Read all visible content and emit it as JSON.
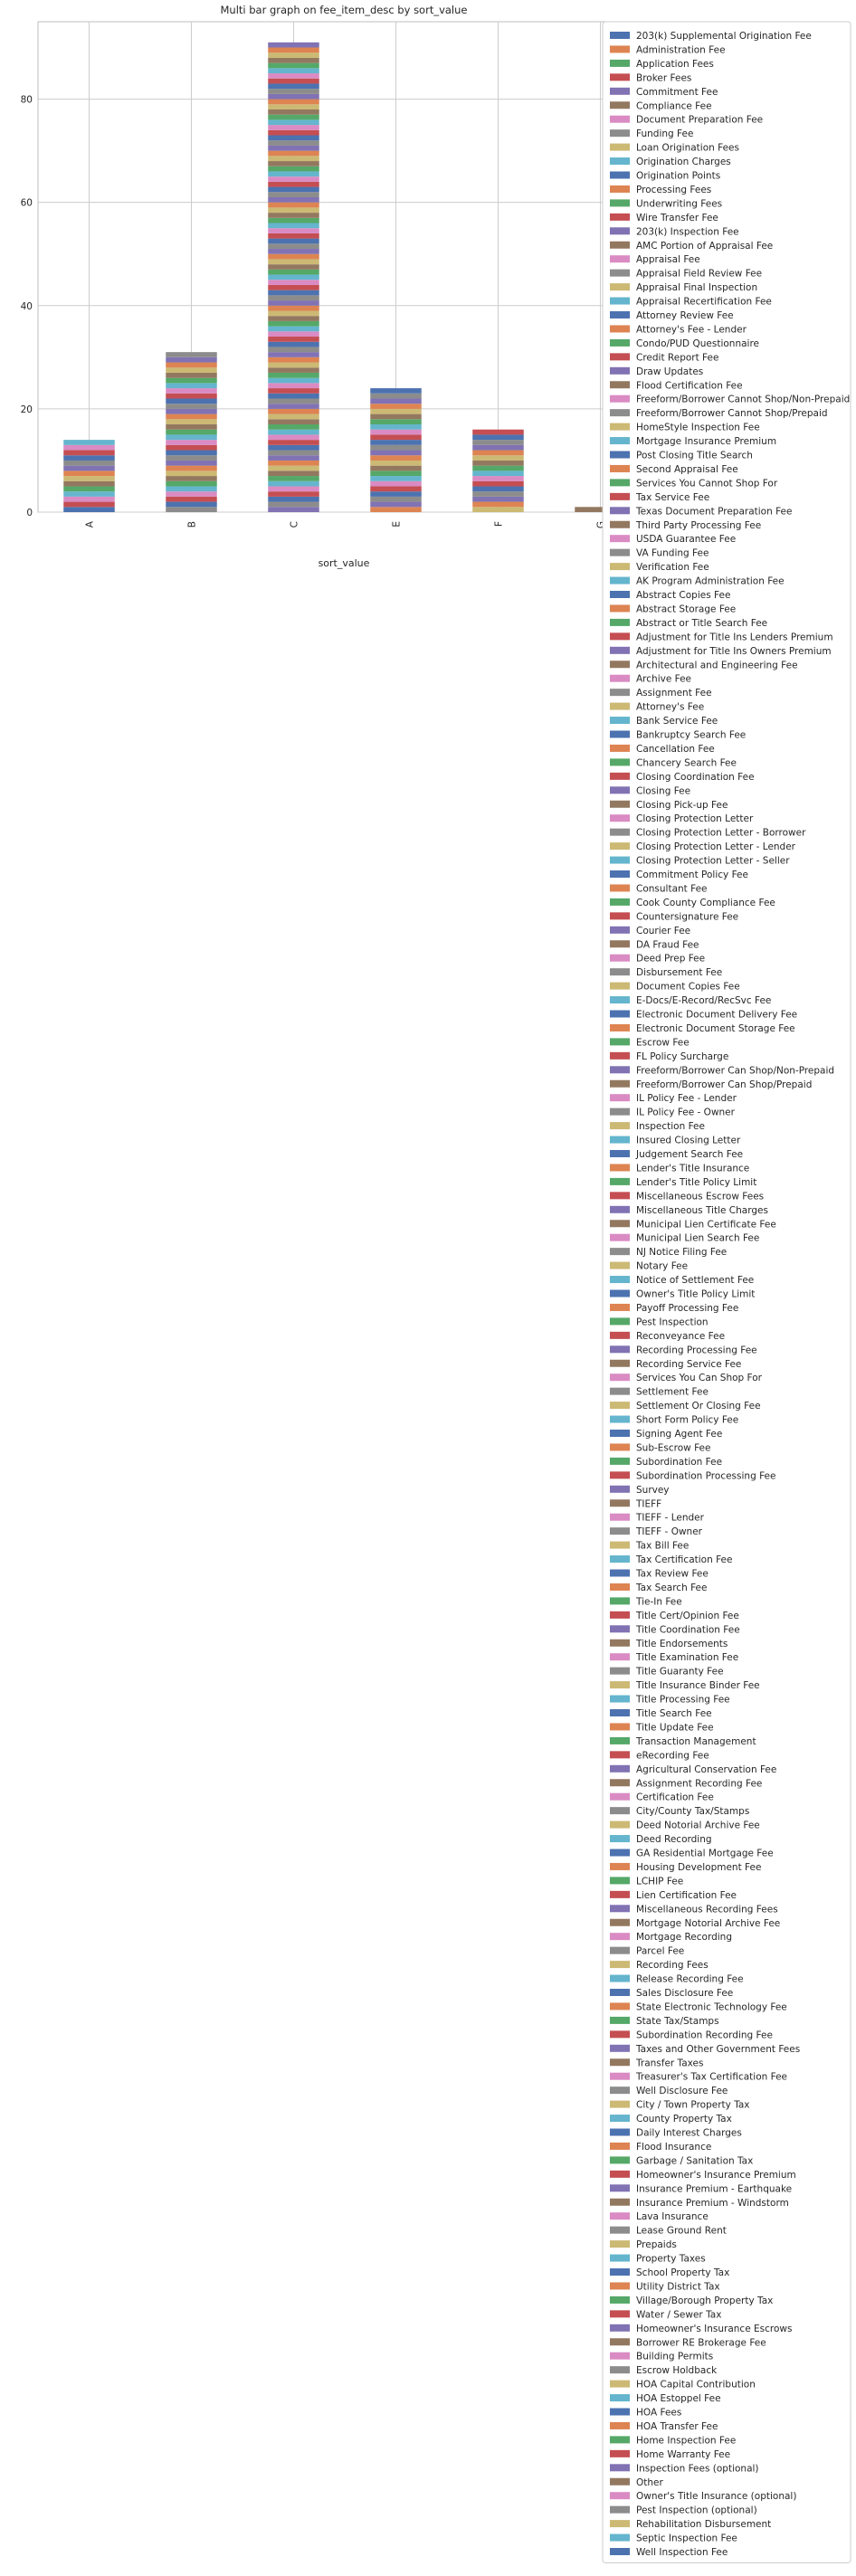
{
  "chart_data": {
    "type": "bar",
    "stacked": true,
    "title": "Multi bar graph on fee_item_desc by sort_value",
    "xlabel": "sort_value",
    "ylabel": "",
    "categories": [
      "A",
      "B",
      "C",
      "E",
      "F",
      "G"
    ],
    "totals": [
      14,
      31,
      91,
      24,
      16,
      1
    ],
    "ylim": [
      0,
      95
    ],
    "yticks": [
      0,
      20,
      40,
      60,
      80
    ],
    "grid": true,
    "legend_position": "right",
    "palette": [
      "#4c72b0",
      "#dd8452",
      "#55a868",
      "#c44e52",
      "#8172b3",
      "#937860",
      "#da8bc3",
      "#8c8c8c",
      "#ccb974",
      "#64b5cd"
    ],
    "series": [
      "203(k) Supplemental Origination Fee",
      "Administration Fee",
      "Application Fees",
      "Broker Fees",
      "Commitment Fee",
      "Compliance Fee",
      "Document Preparation Fee",
      "Funding Fee",
      "Loan Origination Fees",
      "Origination Charges",
      "Origination Points",
      "Processing Fees",
      "Underwriting Fees",
      "Wire Transfer Fee",
      "203(k) Inspection Fee",
      "AMC Portion of Appraisal Fee",
      "Appraisal Fee",
      "Appraisal Field Review Fee",
      "Appraisal Final Inspection",
      "Appraisal Recertification Fee",
      "Attorney Review Fee",
      "Attorney's Fee - Lender",
      "Condo/PUD Questionnaire",
      "Credit Report Fee",
      "Draw Updates",
      "Flood Certification Fee",
      "Freeform/Borrower Cannot Shop/Non-Prepaid",
      "Freeform/Borrower Cannot Shop/Prepaid",
      "HomeStyle Inspection Fee",
      "Mortgage Insurance Premium",
      "Post Closing Title Search",
      "Second Appraisal Fee",
      "Services You Cannot Shop For",
      "Tax Service Fee",
      "Texas Document Preparation Fee",
      "Third Party Processing Fee",
      "USDA Guarantee Fee",
      "VA Funding Fee",
      "Verification Fee",
      "AK Program Administration Fee",
      "Abstract Copies Fee",
      "Abstract Storage Fee",
      "Abstract or Title Search Fee",
      "Adjustment for Title Ins Lenders Premium",
      "Adjustment for Title Ins Owners Premium",
      "Architectural and Engineering Fee",
      "Archive Fee",
      "Assignment Fee",
      "Attorney's Fee",
      "Bank Service Fee",
      "Bankruptcy Search Fee",
      "Cancellation Fee",
      "Chancery Search Fee",
      "Closing Coordination Fee",
      "Closing Fee",
      "Closing Pick-up Fee",
      "Closing Protection Letter",
      "Closing Protection Letter - Borrower",
      "Closing Protection Letter - Lender",
      "Closing Protection Letter - Seller",
      "Commitment Policy Fee",
      "Consultant Fee",
      "Cook County Compliance Fee",
      "Countersignature Fee",
      "Courier Fee",
      "DA Fraud Fee",
      "Deed Prep Fee",
      "Disbursement Fee",
      "Document Copies Fee",
      "E-Docs/E-Record/RecSvc Fee",
      "Electronic Document Delivery Fee",
      "Electronic Document Storage Fee",
      "Escrow Fee",
      "FL Policy Surcharge",
      "Freeform/Borrower Can Shop/Non-Prepaid",
      "Freeform/Borrower Can Shop/Prepaid",
      "IL Policy Fee - Lender",
      "IL Policy Fee - Owner",
      "Inspection Fee",
      "Insured Closing Letter",
      "Judgement Search Fee",
      "Lender's Title Insurance",
      "Lender's Title Policy Limit",
      "Miscellaneous Escrow Fees",
      "Miscellaneous Title Charges",
      "Municipal Lien Certificate Fee",
      "Municipal Lien Search Fee",
      "NJ Notice Filing Fee",
      "Notary Fee",
      "Notice of Settlement Fee",
      "Owner's Title Policy Limit",
      "Payoff Processing Fee",
      "Pest Inspection",
      "Reconveyance Fee",
      "Recording Processing Fee",
      "Recording Service Fee",
      "Services You Can Shop For",
      "Settlement Fee",
      "Settlement Or Closing Fee",
      "Short Form Policy Fee",
      "Signing Agent Fee",
      "Sub-Escrow Fee",
      "Subordination Fee",
      "Subordination Processing Fee",
      "Survey",
      "TIEFF",
      "TIEFF - Lender",
      "TIEFF - Owner",
      "Tax Bill Fee",
      "Tax Certification Fee",
      "Tax Review Fee",
      "Tax Search Fee",
      "Tie-In Fee",
      "Title Cert/Opinion Fee",
      "Title Coordination Fee",
      "Title Endorsements",
      "Title Examination Fee",
      "Title Guaranty Fee",
      "Title Insurance Binder Fee",
      "Title Processing Fee",
      "Title Search Fee",
      "Title Update Fee",
      "Transaction Management",
      "eRecording Fee",
      "Agricultural Conservation Fee",
      "Assignment Recording Fee",
      "Certification Fee",
      "City/County Tax/Stamps",
      "Deed Notorial Archive Fee",
      "Deed Recording",
      "GA Residential Mortgage Fee",
      "Housing Development Fee",
      "LCHIP Fee",
      "Lien Certification Fee",
      "Miscellaneous Recording Fees",
      "Mortgage Notorial Archive Fee",
      "Mortgage Recording",
      "Parcel Fee",
      "Recording Fees",
      "Release Recording Fee",
      "Sales Disclosure Fee",
      "State Electronic Technology Fee",
      "State Tax/Stamps",
      "Subordination Recording Fee",
      "Taxes and Other Government Fees",
      "Transfer Taxes",
      "Treasurer's Tax Certification Fee",
      "Well Disclosure Fee",
      "City / Town Property Tax",
      "County Property Tax",
      "Daily Interest Charges",
      "Flood Insurance",
      "Garbage / Sanitation Tax",
      "Homeowner's Insurance Premium",
      "Insurance Premium - Earthquake",
      "Insurance Premium - Windstorm",
      "Lava Insurance",
      "Lease Ground Rent",
      "Prepaids",
      "Property Taxes",
      "School Property Tax",
      "Utility District Tax",
      "Village/Borough Property Tax",
      "Water / Sewer Tax",
      "Homeowner's Insurance Escrows",
      "Borrower RE Brokerage Fee",
      "Building Permits",
      "Escrow Holdback",
      "HOA Capital Contribution",
      "HOA Estoppel Fee",
      "HOA Fees",
      "HOA Transfer Fee",
      "Home Inspection Fee",
      "Home Warranty Fee",
      "Inspection Fees (optional)",
      "Other",
      "Owner's Title Insurance (optional)",
      "Pest Inspection (optional)",
      "Rehabilitation Disbursement",
      "Septic Inspection Fee",
      "Well Inspection Fee"
    ]
  }
}
